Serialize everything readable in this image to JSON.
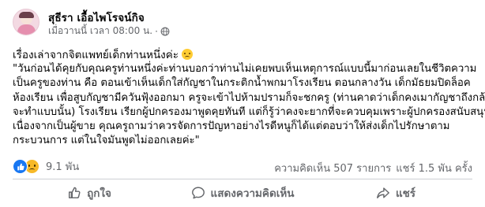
{
  "post": {
    "author": "สุธีรา เอื้อไพโรจน์กิจ",
    "time": "เมื่อวานนี้ เวลา 08:00 น.",
    "separator": "·",
    "audience_icon": "globe-icon",
    "title": "เรื่องเล่าจากจิตแพทย์เด็กท่านหนึ่งค่ะ",
    "title_emoji": "sad-face-icon",
    "body_lines": [
      "\"วันก่อนได้คุยกับคุณครูท่านหนึ่งค่ะท่านบอกว่าท่านไม่เคยพบเห็นเหตุการณ์แบบนี้มาก่อนเลยในชีวิตความ",
      "เป็นครูของท่าน คือ ตอนเข้าเห็นเด็กใส่กัญชาในกระติกน้ำพกมาโรงเรียน ตอนกลางวัน เด็กมัธยมปิดล็อค",
      "ห้องเรียน เพื่อสูบกัญชามีควันฟุ้งออกมา ครูจะเข้าไปห้ามปรามก็จะชกครู (ท่านคาดว่าเด็กคงเมากัญชาถึงกล้า",
      "จะทำแบบนั้น) โรงเรียน เรียกผู้ปกครองมาพูดคุยทันที แต่ก็รู้ว่าคงจะยากที่จะควบคุมเพราะผู้ปกครองสนับสนุน",
      "เนื่องจากเป็นผู้ขาย คุณครูถามว่าควรจัดการปัญหาอย่างไรดีหนูก็ได้แต่ตอบว่าให้ส่งเด็กไปรักษาตาม",
      "กระบวนการ แต่ในใจมันพูดไม่ออกเลยค่ะ\""
    ]
  },
  "reactions": {
    "icons": [
      "like-reaction-icon",
      "sad-reaction-icon"
    ],
    "count": "9.1 พัน"
  },
  "stats": {
    "comments": "ความคิดเห็น 507 รายการ",
    "shares": "แชร์ 1.5 พัน ครั้ง"
  },
  "actions": [
    {
      "label": "ถูกใจ",
      "icon": "like-icon"
    },
    {
      "label": "แสดงความคิดเห็น",
      "icon": "comment-icon"
    },
    {
      "label": "แชร์",
      "icon": "share-icon"
    }
  ],
  "colors": {
    "accent": "#1877f2",
    "secondary_text": "#65676b",
    "divider": "#ced0d4",
    "sad_reaction": "#f7b928"
  }
}
